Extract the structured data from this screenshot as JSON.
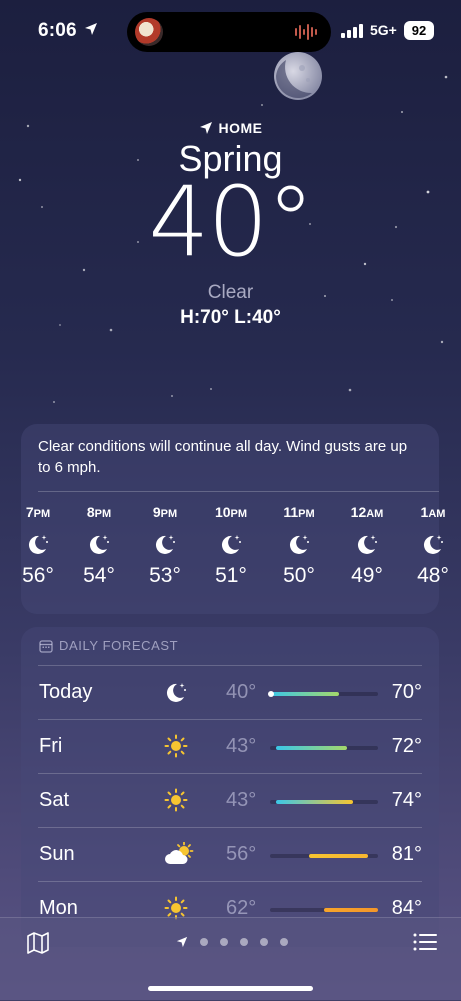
{
  "status": {
    "time": "6:06",
    "network": "5G+",
    "battery": "92"
  },
  "hero": {
    "home_label": "HOME",
    "city": "Spring",
    "temperature": "40°",
    "condition": "Clear",
    "hi_lo": "H:70°  L:40°"
  },
  "hourly": {
    "summary": "Clear conditions will continue all day. Wind gusts are up to 6 mph.",
    "hours": [
      {
        "time": "7",
        "ampm": "PM",
        "temp": "56°",
        "icon": "moon-stars-icon"
      },
      {
        "time": "8",
        "ampm": "PM",
        "temp": "54°",
        "icon": "moon-stars-icon"
      },
      {
        "time": "9",
        "ampm": "PM",
        "temp": "53°",
        "icon": "moon-stars-icon"
      },
      {
        "time": "10",
        "ampm": "PM",
        "temp": "51°",
        "icon": "moon-stars-icon"
      },
      {
        "time": "11",
        "ampm": "PM",
        "temp": "50°",
        "icon": "moon-stars-icon"
      },
      {
        "time": "12",
        "ampm": "AM",
        "temp": "49°",
        "icon": "moon-stars-icon"
      },
      {
        "time": "1",
        "ampm": "AM",
        "temp": "48°",
        "icon": "moon-stars-icon"
      }
    ]
  },
  "daily": {
    "header": "DAILY FORECAST",
    "days": [
      {
        "day": "Today",
        "icon": "moon-stars-icon",
        "low": "40°",
        "high": "70°"
      },
      {
        "day": "Fri",
        "icon": "sun-icon",
        "low": "43°",
        "high": "72°"
      },
      {
        "day": "Sat",
        "icon": "sun-icon",
        "low": "43°",
        "high": "74°"
      },
      {
        "day": "Sun",
        "icon": "partly-cloudy-icon",
        "low": "56°",
        "high": "81°"
      },
      {
        "day": "Mon",
        "icon": "sun-icon",
        "low": "62°",
        "high": "84°"
      }
    ]
  },
  "colors": {
    "accent_cool": "#3bc7e8",
    "accent_mid": "#a5d86a",
    "accent_warm": "#f7c531",
    "accent_hot": "#f4962a"
  }
}
